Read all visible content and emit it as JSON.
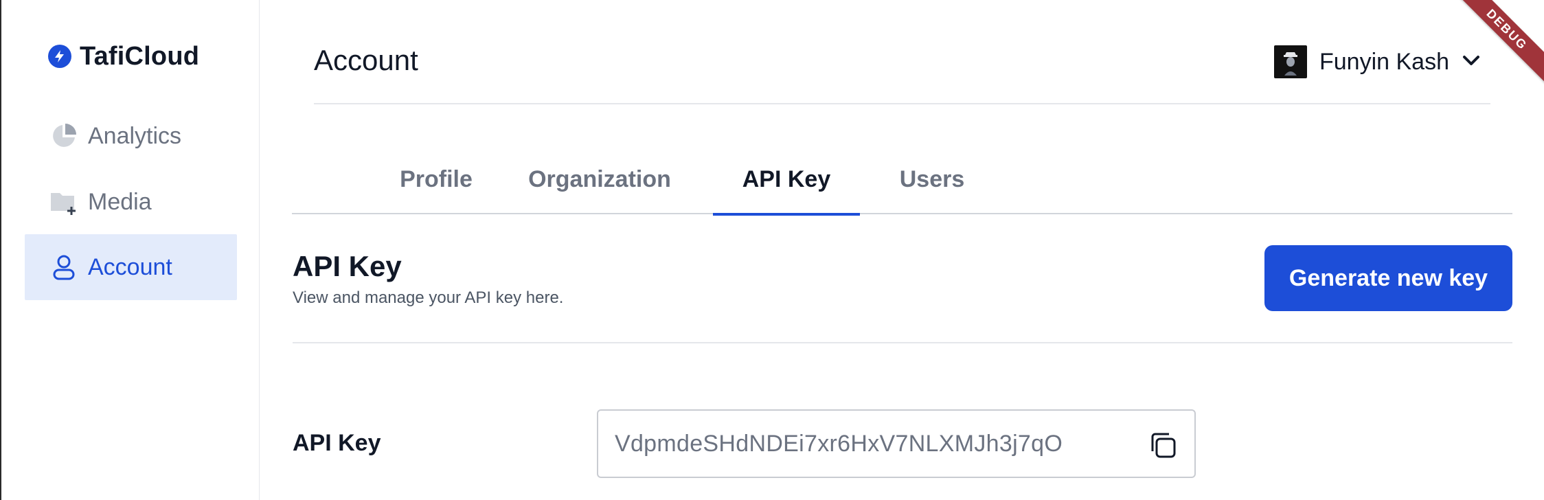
{
  "brand": {
    "name": "TafiCloud"
  },
  "sidebar": {
    "items": [
      {
        "label": "Analytics",
        "icon": "pie-chart-icon",
        "active": false
      },
      {
        "label": "Media",
        "icon": "folder-add-icon",
        "active": false
      },
      {
        "label": "Account",
        "icon": "user-icon",
        "active": true
      }
    ]
  },
  "header": {
    "title": "Account",
    "user": {
      "name": "Funyin Kash"
    }
  },
  "tabs": [
    {
      "label": "Profile",
      "active": false
    },
    {
      "label": "Organization",
      "active": false
    },
    {
      "label": "API Key",
      "active": true
    },
    {
      "label": "Users",
      "active": false
    }
  ],
  "section": {
    "title": "API Key",
    "subtitle": "View and manage your API key here.",
    "generate_label": "Generate new key"
  },
  "api_key": {
    "label": "API Key",
    "value": "VdpmdeSHdNDEi7xr6HxV7NLXMJh3j7qO"
  },
  "debug_banner": "DEBUG",
  "colors": {
    "accent": "#1d4ed8",
    "active_bg": "#e3ebfb",
    "muted_text": "#6b7280"
  }
}
